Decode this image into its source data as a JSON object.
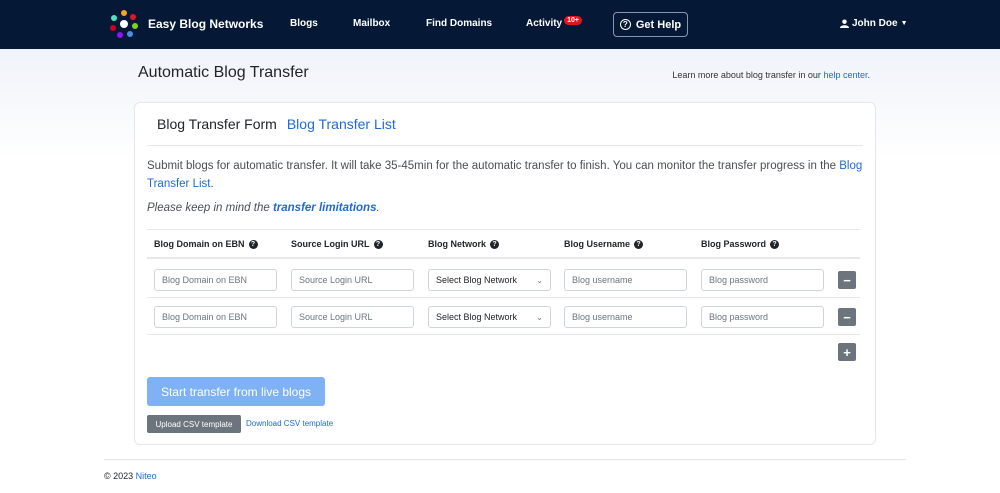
{
  "navbar": {
    "brand": "Easy Blog Networks",
    "items": [
      {
        "label": "Blogs"
      },
      {
        "label": "Mailbox"
      },
      {
        "label": "Find Domains"
      },
      {
        "label": "Activity",
        "badge": "10+"
      }
    ],
    "help_label": "Get Help",
    "user_name": "John Doe",
    "colors": {
      "background": "#051937",
      "badge": "#e3141e"
    }
  },
  "header": {
    "title": "Automatic Blog Transfer",
    "help_prefix": "Learn more about blog transfer in our",
    "help_link": "help center",
    "help_suffix": "."
  },
  "tabs": {
    "active": "Blog Transfer Form",
    "other": "Blog Transfer List"
  },
  "description": {
    "text": "Submit blogs for automatic transfer. It will take 35-45min for the automatic transfer to finish. You can monitor the transfer progress in the",
    "link": "Blog Transfer List",
    "suffix": ".",
    "note_prefix": "Please keep in mind the",
    "note_link": "transfer limitations",
    "note_suffix": "."
  },
  "table": {
    "headers": [
      "Blog Domain on EBN",
      "Source Login URL",
      "Blog Network",
      "Blog Username",
      "Blog Password"
    ],
    "rows": [
      {
        "domain_placeholder": "Blog Domain on EBN",
        "login_placeholder": "Source Login URL",
        "network_value": "Select Blog Network",
        "username_placeholder": "Blog username",
        "password_placeholder": "Blog password"
      },
      {
        "domain_placeholder": "Blog Domain on EBN",
        "login_placeholder": "Source Login URL",
        "network_value": "Select Blog Network",
        "username_placeholder": "Blog username",
        "password_placeholder": "Blog password"
      }
    ],
    "remove_label": "−",
    "add_label": "+"
  },
  "actions": {
    "start_label": "Start transfer from live blogs",
    "upload_label": "Upload CSV template",
    "download_label": "Download CSV template"
  },
  "footer": {
    "copyright": "© 2023",
    "company": "Niteo"
  },
  "accent_color": "#1e6bd6"
}
